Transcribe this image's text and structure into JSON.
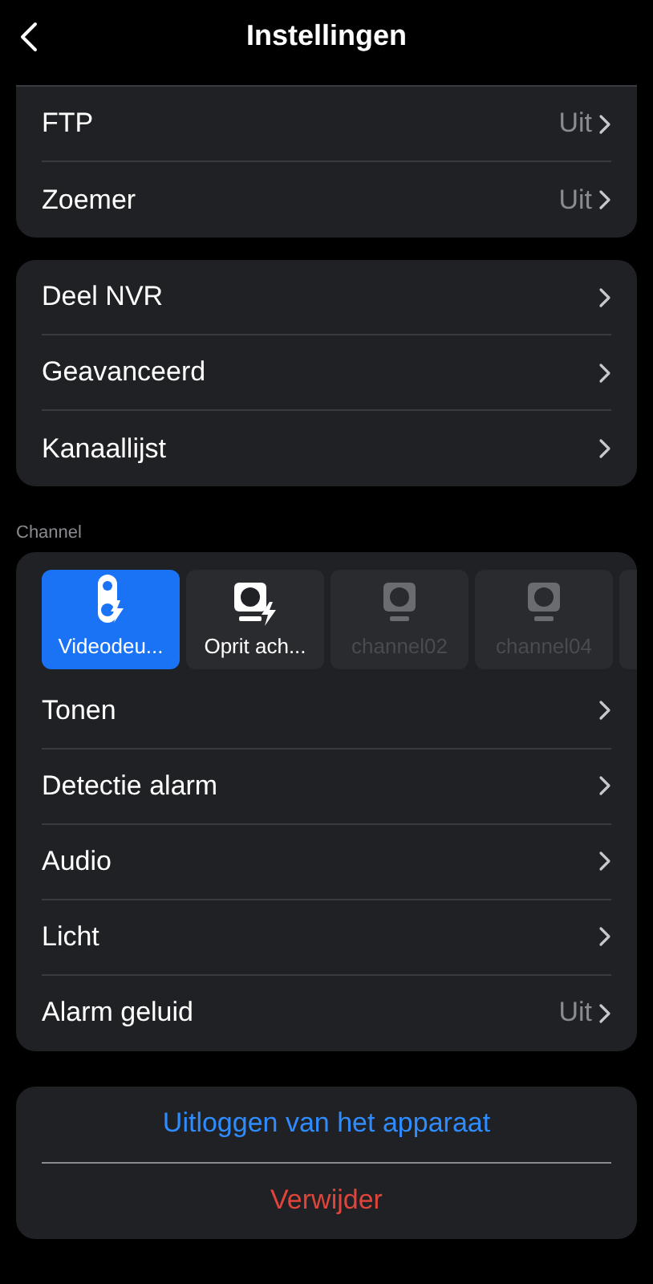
{
  "header": {
    "title": "Instellingen"
  },
  "group_1": [
    {
      "label": "FTP",
      "value": "Uit"
    },
    {
      "label": "Zoemer",
      "value": "Uit"
    }
  ],
  "group_2": [
    {
      "label": "Deel NVR"
    },
    {
      "label": "Geavanceerd"
    },
    {
      "label": "Kanaallijst"
    }
  ],
  "channel_section": {
    "heading": "Channel",
    "channels": [
      {
        "kind": "doorbell",
        "name": "Videodeu...",
        "selected": true,
        "disabled": false
      },
      {
        "kind": "camera-bolt",
        "name": "Oprit ach...",
        "selected": false,
        "disabled": false
      },
      {
        "kind": "camera",
        "name": "channel02",
        "selected": false,
        "disabled": true
      },
      {
        "kind": "camera",
        "name": "channel04",
        "selected": false,
        "disabled": true
      }
    ],
    "rows": [
      {
        "label": "Tonen"
      },
      {
        "label": "Detectie alarm"
      },
      {
        "label": "Audio"
      },
      {
        "label": "Licht"
      },
      {
        "label": "Alarm geluid",
        "value": "Uit"
      }
    ]
  },
  "actions": [
    {
      "kind": "primary",
      "label": "Uitloggen van het apparaat"
    },
    {
      "kind": "danger",
      "label": "Verwijder"
    }
  ]
}
